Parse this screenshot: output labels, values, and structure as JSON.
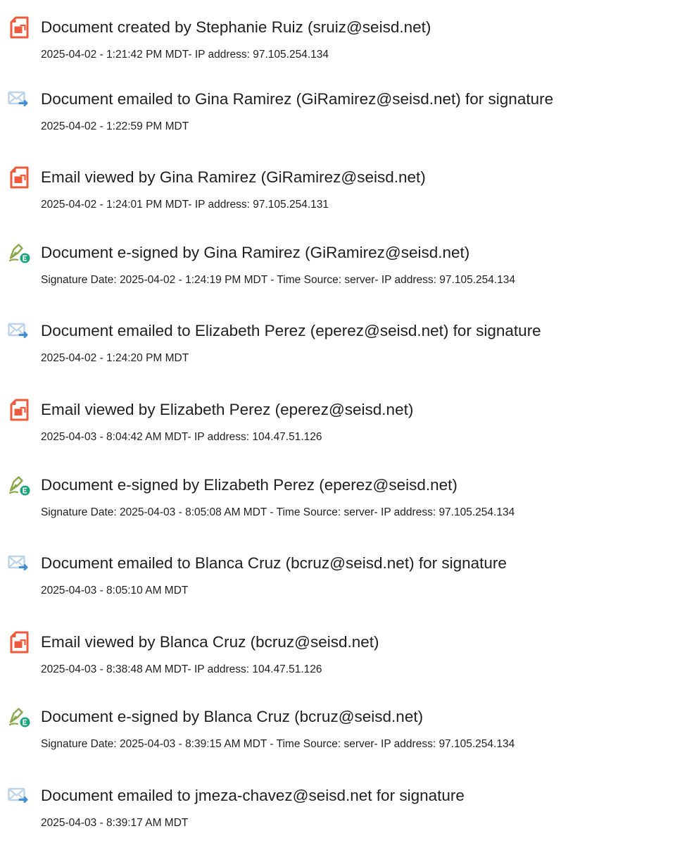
{
  "events": [
    {
      "icon": "document-created-icon",
      "title": "Document created by Stephanie Ruiz (sruiz@seisd.net)",
      "detail": "2025-04-02 - 1:21:42 PM MDT- IP address: 97.105.254.134"
    },
    {
      "icon": "document-emailed-icon",
      "title": "Document emailed to Gina Ramirez (GiRamirez@seisd.net) for signature",
      "detail": "2025-04-02 - 1:22:59 PM MDT"
    },
    {
      "icon": "email-viewed-icon",
      "title": "Email viewed by Gina Ramirez (GiRamirez@seisd.net)",
      "detail": "2025-04-02 - 1:24:01 PM MDT- IP address: 97.105.254.131"
    },
    {
      "icon": "e-signed-icon",
      "title": "Document e-signed by Gina Ramirez (GiRamirez@seisd.net)",
      "detail": "Signature Date: 2025-04-02 - 1:24:19 PM MDT - Time Source: server- IP address: 97.105.254.134"
    },
    {
      "icon": "document-emailed-icon",
      "title": "Document emailed to Elizabeth Perez (eperez@seisd.net) for signature",
      "detail": "2025-04-02 - 1:24:20 PM MDT"
    },
    {
      "icon": "email-viewed-icon",
      "title": "Email viewed by Elizabeth Perez (eperez@seisd.net)",
      "detail": "2025-04-03 - 8:04:42 AM MDT- IP address: 104.47.51.126"
    },
    {
      "icon": "e-signed-icon",
      "title": "Document e-signed by Elizabeth Perez (eperez@seisd.net)",
      "detail": "Signature Date: 2025-04-03 - 8:05:08 AM MDT - Time Source: server- IP address: 97.105.254.134"
    },
    {
      "icon": "document-emailed-icon",
      "title": "Document emailed to Blanca Cruz (bcruz@seisd.net) for signature",
      "detail": "2025-04-03 - 8:05:10 AM MDT"
    },
    {
      "icon": "email-viewed-icon",
      "title": "Email viewed by Blanca Cruz (bcruz@seisd.net)",
      "detail": "2025-04-03 - 8:38:48 AM MDT- IP address: 104.47.51.126"
    },
    {
      "icon": "e-signed-icon",
      "title": "Document e-signed by Blanca Cruz (bcruz@seisd.net)",
      "detail": "Signature Date: 2025-04-03 - 8:39:15 AM MDT - Time Source: server- IP address: 97.105.254.134"
    },
    {
      "icon": "document-emailed-icon",
      "title": "Document emailed to jmeza-chavez@seisd.net for signature",
      "detail": "2025-04-03 - 8:39:17 AM MDT"
    }
  ],
  "colors": {
    "document_icon": "#ef5a3c",
    "email_icon_light": "#bcd3ea",
    "email_icon_blue": "#3f8ed6",
    "sign_pen": "#8aa84a",
    "sign_badge": "#17a57a",
    "text": "#1f1f1f"
  }
}
